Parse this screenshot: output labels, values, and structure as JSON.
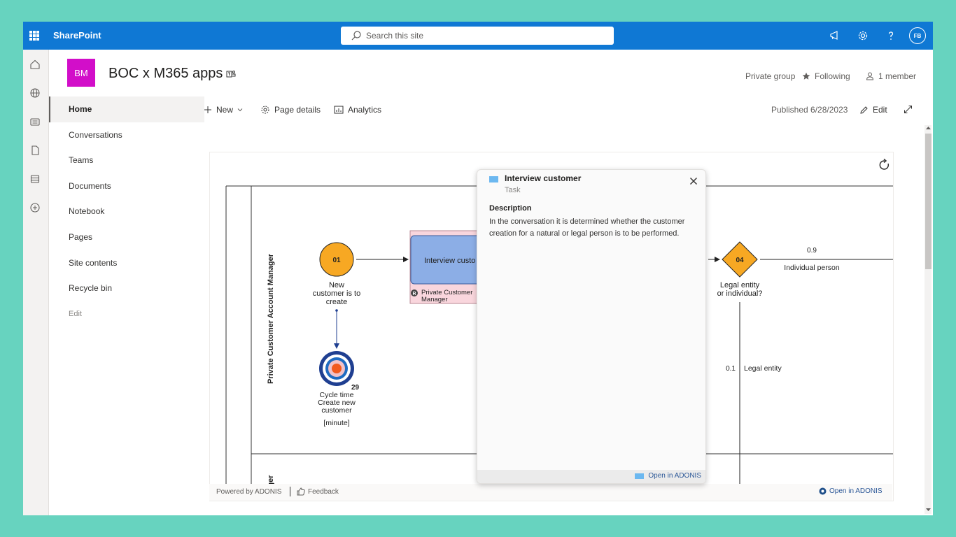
{
  "suite": {
    "app_name": "SharePoint",
    "search_placeholder": "Search this site",
    "avatar_initials": "FB"
  },
  "site": {
    "logo_text": "BM",
    "title": "BOC x M365 apps",
    "privacy": "Private group",
    "following": "Following",
    "members": "1 member"
  },
  "nav": {
    "items": [
      "Home",
      "Conversations",
      "Teams",
      "Documents",
      "Notebook",
      "Pages",
      "Site contents",
      "Recycle bin",
      "Edit"
    ]
  },
  "command_bar": {
    "new_label": "New",
    "page_details": "Page details",
    "analytics": "Analytics",
    "published": "Published 6/28/2023",
    "edit": "Edit"
  },
  "diagram": {
    "lane_title": "Private Customer Account Manager",
    "lane2_partial": "ger",
    "start_event_number": "01",
    "start_event_label": [
      "New",
      "customer is to",
      "create"
    ],
    "task_label": "Interview custo",
    "task_role": [
      "Private Customer",
      "Manager"
    ],
    "gateway_number": "04",
    "gateway_label": [
      "Legal entity",
      "or individual?"
    ],
    "branch1_probability": "0.9",
    "branch1_label": "Individual person",
    "branch2_probability": "0.1",
    "branch2_label": "Legal entity",
    "kpi_value": "29",
    "kpi_label": [
      "Cycle time",
      "Create new",
      "customer"
    ],
    "kpi_unit": "[minute]"
  },
  "popup": {
    "title": "Interview customer",
    "type": "Task",
    "description_label": "Description",
    "description": "In the conversation it is determined whether the customer creation for a natural or legal person is to be performed.",
    "open_label": "Open in ADONIS"
  },
  "footer": {
    "powered_by": "Powered by ADONIS",
    "feedback": "Feedback",
    "open_label": "Open in ADONIS"
  },
  "colors": {
    "suite_bar": "#0f78d4",
    "site_logo": "#d20ec9",
    "event_fill": "#f7a823",
    "task_fill": "#8caee6",
    "role_bg": "#f9d6dd",
    "adonis_blue": "#2b5797"
  }
}
